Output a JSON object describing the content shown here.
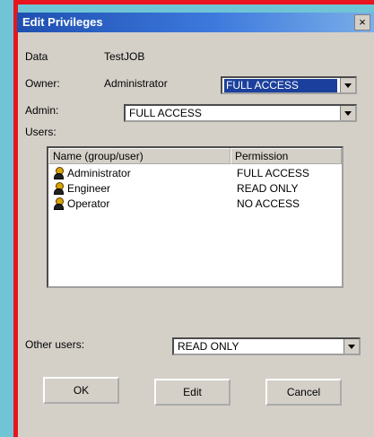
{
  "window": {
    "title": "Edit Privileges",
    "close_glyph": "×"
  },
  "fields": {
    "data_label": "Data",
    "data_value": "TestJOB",
    "owner_label": "Owner:",
    "owner_value": "Administrator",
    "owner_access": "FULL ACCESS",
    "admin_label": "Admin:",
    "admin_access": "FULL ACCESS",
    "users_label": "Users:"
  },
  "users_table": {
    "columns": [
      "Name (group/user)",
      "Permission"
    ],
    "rows": [
      {
        "name": "Administrator",
        "permission": "FULL ACCESS"
      },
      {
        "name": "Engineer",
        "permission": "READ ONLY"
      },
      {
        "name": "Operator",
        "permission": "NO ACCESS"
      }
    ]
  },
  "other_users": {
    "label": "Other users:",
    "access": "READ ONLY"
  },
  "buttons": {
    "ok": "OK",
    "edit": "Edit",
    "cancel": "Cancel"
  },
  "colors": {
    "title_bar": "#1e4fb0",
    "selection": "#1b3f9c",
    "accent_red": "#e8141e",
    "dialog_bg": "#d4d0c8"
  }
}
